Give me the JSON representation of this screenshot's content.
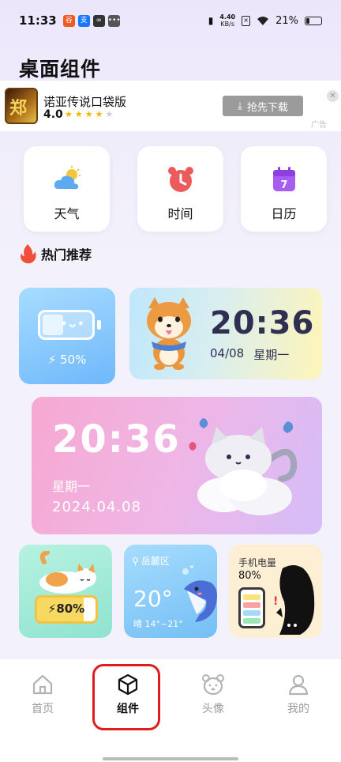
{
  "status": {
    "time": "11:33",
    "net_speed_top": "4.40",
    "net_speed_unit": "KB/s",
    "battery": "21%"
  },
  "page_title": "桌面组件",
  "ad": {
    "logo_text": "郑",
    "title": "诺亚传说口袋版",
    "rating": "4.0",
    "stars": 4,
    "button": "抢先下载",
    "close": "✕",
    "tag": "广告"
  },
  "categories": [
    {
      "label": "天气",
      "icon": "weather-icon"
    },
    {
      "label": "时间",
      "icon": "alarm-clock-icon"
    },
    {
      "label": "日历",
      "icon": "calendar-icon",
      "day": "7"
    }
  ],
  "hot_section": {
    "title": "热门推荐",
    "icon": "flame-icon"
  },
  "widgets": {
    "battery_face": {
      "value": "50%"
    },
    "shiba_clock": {
      "time": "20:36",
      "date": "04/08",
      "weekday": "星期一"
    },
    "cat_clock": {
      "time": "20:36",
      "weekday": "星期一",
      "date": "2024.04.08"
    },
    "cat_battery": {
      "value": "80%"
    },
    "weather": {
      "location": "岳麓区",
      "temp": "20°",
      "desc": "晴 14°~21°"
    },
    "phone_battery": {
      "title": "手机电量",
      "value": "80%"
    }
  },
  "nav": [
    {
      "label": "首页",
      "icon": "home-icon",
      "active": false
    },
    {
      "label": "组件",
      "icon": "cube-icon",
      "active": true
    },
    {
      "label": "头像",
      "icon": "bear-icon",
      "active": false
    },
    {
      "label": "我的",
      "icon": "person-icon",
      "active": false
    }
  ],
  "colors": {
    "accent": "#e01d1d",
    "active_nav": "#111111",
    "inactive_nav": "#9a9a9a"
  }
}
